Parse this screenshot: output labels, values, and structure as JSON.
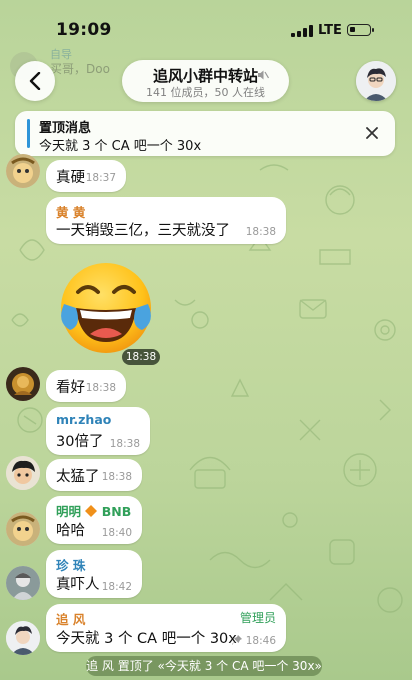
{
  "status_bar": {
    "time": "19:09",
    "network": "LTE"
  },
  "header": {
    "group_name": "追风小群中转站",
    "subtitle": "141 位成员，50 人在线",
    "muted": true
  },
  "background_preview": {
    "sender": "自导",
    "text": "买哥，Doo"
  },
  "pinned": {
    "label": "置顶消息",
    "text": "今天就 3 个 CA 吧一个 30x"
  },
  "messages": [
    {
      "sender": "",
      "text": "真硬",
      "time": "18:37"
    },
    {
      "sender": "黄 黄",
      "text": "一天销毁三亿，三天就没了",
      "time": "18:38"
    },
    {
      "sender": "",
      "sticker": "laughing-tears-emoji",
      "time": "18:38"
    },
    {
      "sender": "",
      "text": "看好",
      "time": "18:38"
    },
    {
      "sender": "mr.zhao",
      "text": "30倍了",
      "time": "18:38"
    },
    {
      "sender": "",
      "text": "太猛了",
      "time": "18:38"
    },
    {
      "sender": "明明",
      "sender_suffix": "BNB",
      "text": "哈哈",
      "time": "18:40"
    },
    {
      "sender": "珍 珠",
      "text": "真吓人",
      "time": "18:42"
    },
    {
      "sender": "追 风",
      "badge": "管理员",
      "text": "今天就 3 个 CA 吧一个 30x",
      "time": "18:46",
      "pinned": true
    }
  ],
  "service_message": "追 风 置顶了 «今天就 3 个 CA 吧一个 30x»",
  "colors": {
    "accent": "#2f95d8",
    "sender_orange": "#d9822b",
    "sender_blue": "#2f83b8",
    "sender_green": "#31a05a",
    "admin_badge": "#31a05a"
  }
}
